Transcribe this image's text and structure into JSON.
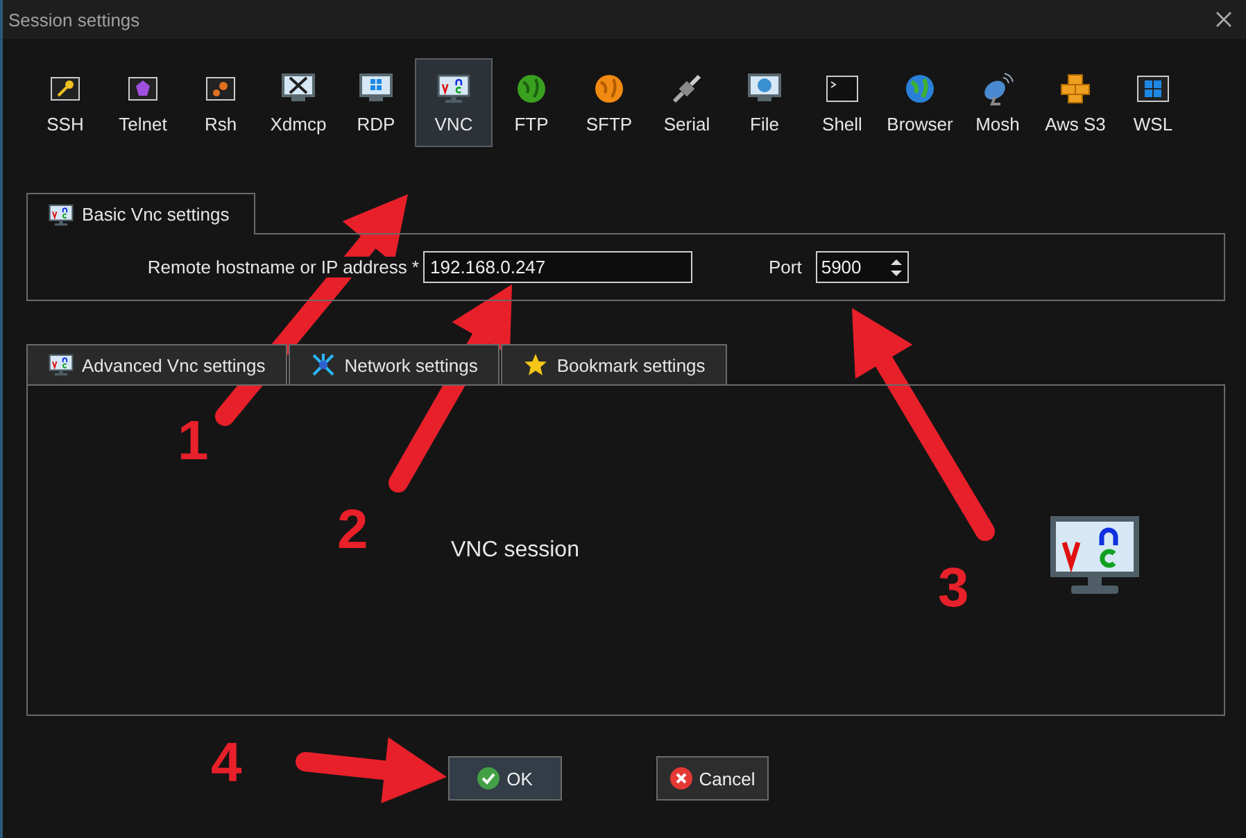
{
  "window": {
    "title": "Session settings"
  },
  "protocols": [
    {
      "label": "SSH",
      "selected": false
    },
    {
      "label": "Telnet",
      "selected": false
    },
    {
      "label": "Rsh",
      "selected": false
    },
    {
      "label": "Xdmcp",
      "selected": false
    },
    {
      "label": "RDP",
      "selected": false
    },
    {
      "label": "VNC",
      "selected": true
    },
    {
      "label": "FTP",
      "selected": false
    },
    {
      "label": "SFTP",
      "selected": false
    },
    {
      "label": "Serial",
      "selected": false
    },
    {
      "label": "File",
      "selected": false
    },
    {
      "label": "Shell",
      "selected": false
    },
    {
      "label": "Browser",
      "selected": false
    },
    {
      "label": "Mosh",
      "selected": false
    },
    {
      "label": "Aws S3",
      "selected": false
    },
    {
      "label": "WSL",
      "selected": false
    }
  ],
  "basic": {
    "tab": "Basic Vnc settings",
    "host_label": "Remote hostname or IP address *",
    "host_value": "192.168.0.247",
    "port_label": "Port",
    "port_value": "5900"
  },
  "tabs": [
    {
      "label": "Advanced Vnc settings"
    },
    {
      "label": "Network settings"
    },
    {
      "label": "Bookmark settings"
    }
  ],
  "panel": {
    "text": "VNC session"
  },
  "buttons": [
    {
      "label": "OK",
      "kind": "ok"
    },
    {
      "label": "Cancel",
      "kind": "cancel"
    }
  ],
  "annotations": [
    {
      "number": "1"
    },
    {
      "number": "2"
    },
    {
      "number": "3"
    },
    {
      "number": "4"
    }
  ]
}
